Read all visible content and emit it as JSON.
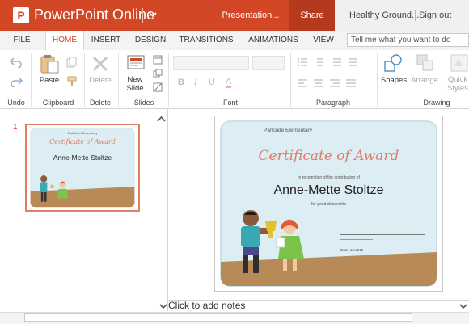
{
  "app": {
    "title": "PowerPoint Online",
    "logo_letter": "P",
    "doc_name": "Presentation...",
    "share_label": "Share",
    "user_name": "Healthy Ground...",
    "sign_out_label": "Sign out"
  },
  "tabs": [
    {
      "label": "FILE"
    },
    {
      "label": "HOME",
      "active": true
    },
    {
      "label": "INSERT"
    },
    {
      "label": "DESIGN"
    },
    {
      "label": "TRANSITIONS"
    },
    {
      "label": "ANIMATIONS"
    },
    {
      "label": "VIEW"
    }
  ],
  "tell_me": {
    "placeholder": "Tell me what you want to do"
  },
  "ribbon": {
    "undo_group": "Undo",
    "clipboard": {
      "paste": "Paste",
      "group": "Clipboard"
    },
    "delete": {
      "label": "Delete",
      "group": "Delete"
    },
    "slides": {
      "new_slide_line1": "New",
      "new_slide_line2": "Slide",
      "group": "Slides"
    },
    "font": {
      "group": "Font",
      "bold": "B",
      "italic": "I",
      "underline": "U",
      "color": "A"
    },
    "paragraph": {
      "group": "Paragraph"
    },
    "drawing": {
      "group": "Drawing",
      "shapes": "Shapes",
      "arrange": "Arrange",
      "quick_styles_line1": "Quick",
      "quick_styles_line2": "Styles"
    }
  },
  "slide_panel": {
    "slide_number": "1"
  },
  "certificate": {
    "school": "Parkside Elementary",
    "title": "Certificate of Award",
    "subtitle": "In recognition of the contribution of",
    "name": "Anne-Mette Stoltze",
    "reason": "for good citizenship",
    "date_label": "Date: 10.2012"
  },
  "notes": {
    "placeholder": "Click to add notes"
  },
  "colors": {
    "brand": "#d24726",
    "share_bg": "#b5391c",
    "slide_bg": "#dcedf4",
    "ground": "#b88a57"
  }
}
